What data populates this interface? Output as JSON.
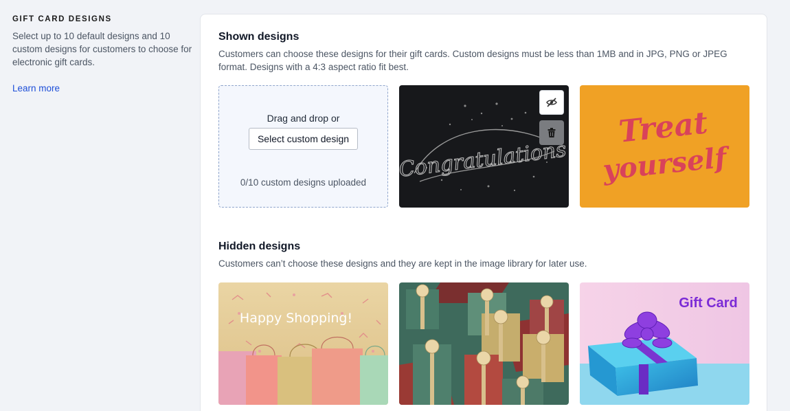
{
  "sidebar": {
    "heading": "GIFT CARD DESIGNS",
    "description": "Select up to 10 default designs and 10 custom designs for customers to choose for electronic gift cards.",
    "learn_more": "Learn more"
  },
  "shown": {
    "title": "Shown designs",
    "description": "Customers can choose these designs for their gift cards. Custom designs must be less than 1MB and in JPG, PNG or JPEG format. Designs with a 4:3 aspect ratio fit best.",
    "upload": {
      "drag_text": "Drag and drop or",
      "button": "Select custom design",
      "count": "0/10 custom designs uploaded"
    },
    "cards": [
      {
        "name": "congratulations",
        "text": "Congratulations",
        "icons": [
          "eye-slash-icon",
          "trash-icon"
        ]
      },
      {
        "name": "treat-yourself",
        "line1": "Treat",
        "line2": "yourself"
      }
    ]
  },
  "hidden": {
    "title": "Hidden designs",
    "description": "Customers can’t choose these designs and they are kept in the image library for later use.",
    "cards": [
      {
        "name": "happy-shopping",
        "text": "Happy Shopping!"
      },
      {
        "name": "gift-boxes"
      },
      {
        "name": "gift-card-present",
        "text": "Gift Card"
      }
    ]
  },
  "colors": {
    "accent_link": "#1d4ed8",
    "treat_bg": "#f0a125",
    "treat_text": "#d9425a",
    "congrats_bg": "#17181b",
    "gift_card_text": "#7b2bd6"
  }
}
